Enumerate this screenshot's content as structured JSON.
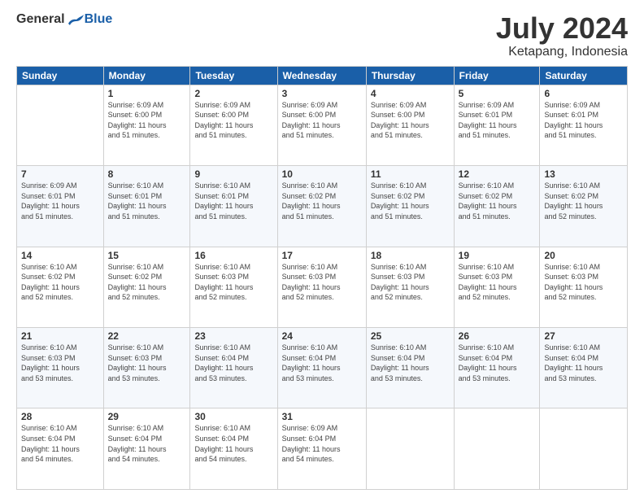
{
  "header": {
    "logo_general": "General",
    "logo_blue": "Blue",
    "month_title": "July 2024",
    "location": "Ketapang, Indonesia"
  },
  "days_header": [
    "Sunday",
    "Monday",
    "Tuesday",
    "Wednesday",
    "Thursday",
    "Friday",
    "Saturday"
  ],
  "weeks": [
    [
      {
        "num": "",
        "info": ""
      },
      {
        "num": "1",
        "info": "Sunrise: 6:09 AM\nSunset: 6:00 PM\nDaylight: 11 hours\nand 51 minutes."
      },
      {
        "num": "2",
        "info": "Sunrise: 6:09 AM\nSunset: 6:00 PM\nDaylight: 11 hours\nand 51 minutes."
      },
      {
        "num": "3",
        "info": "Sunrise: 6:09 AM\nSunset: 6:00 PM\nDaylight: 11 hours\nand 51 minutes."
      },
      {
        "num": "4",
        "info": "Sunrise: 6:09 AM\nSunset: 6:00 PM\nDaylight: 11 hours\nand 51 minutes."
      },
      {
        "num": "5",
        "info": "Sunrise: 6:09 AM\nSunset: 6:01 PM\nDaylight: 11 hours\nand 51 minutes."
      },
      {
        "num": "6",
        "info": "Sunrise: 6:09 AM\nSunset: 6:01 PM\nDaylight: 11 hours\nand 51 minutes."
      }
    ],
    [
      {
        "num": "7",
        "info": "Sunrise: 6:09 AM\nSunset: 6:01 PM\nDaylight: 11 hours\nand 51 minutes."
      },
      {
        "num": "8",
        "info": "Sunrise: 6:10 AM\nSunset: 6:01 PM\nDaylight: 11 hours\nand 51 minutes."
      },
      {
        "num": "9",
        "info": "Sunrise: 6:10 AM\nSunset: 6:01 PM\nDaylight: 11 hours\nand 51 minutes."
      },
      {
        "num": "10",
        "info": "Sunrise: 6:10 AM\nSunset: 6:02 PM\nDaylight: 11 hours\nand 51 minutes."
      },
      {
        "num": "11",
        "info": "Sunrise: 6:10 AM\nSunset: 6:02 PM\nDaylight: 11 hours\nand 51 minutes."
      },
      {
        "num": "12",
        "info": "Sunrise: 6:10 AM\nSunset: 6:02 PM\nDaylight: 11 hours\nand 51 minutes."
      },
      {
        "num": "13",
        "info": "Sunrise: 6:10 AM\nSunset: 6:02 PM\nDaylight: 11 hours\nand 52 minutes."
      }
    ],
    [
      {
        "num": "14",
        "info": "Sunrise: 6:10 AM\nSunset: 6:02 PM\nDaylight: 11 hours\nand 52 minutes."
      },
      {
        "num": "15",
        "info": "Sunrise: 6:10 AM\nSunset: 6:02 PM\nDaylight: 11 hours\nand 52 minutes."
      },
      {
        "num": "16",
        "info": "Sunrise: 6:10 AM\nSunset: 6:03 PM\nDaylight: 11 hours\nand 52 minutes."
      },
      {
        "num": "17",
        "info": "Sunrise: 6:10 AM\nSunset: 6:03 PM\nDaylight: 11 hours\nand 52 minutes."
      },
      {
        "num": "18",
        "info": "Sunrise: 6:10 AM\nSunset: 6:03 PM\nDaylight: 11 hours\nand 52 minutes."
      },
      {
        "num": "19",
        "info": "Sunrise: 6:10 AM\nSunset: 6:03 PM\nDaylight: 11 hours\nand 52 minutes."
      },
      {
        "num": "20",
        "info": "Sunrise: 6:10 AM\nSunset: 6:03 PM\nDaylight: 11 hours\nand 52 minutes."
      }
    ],
    [
      {
        "num": "21",
        "info": "Sunrise: 6:10 AM\nSunset: 6:03 PM\nDaylight: 11 hours\nand 53 minutes."
      },
      {
        "num": "22",
        "info": "Sunrise: 6:10 AM\nSunset: 6:03 PM\nDaylight: 11 hours\nand 53 minutes."
      },
      {
        "num": "23",
        "info": "Sunrise: 6:10 AM\nSunset: 6:04 PM\nDaylight: 11 hours\nand 53 minutes."
      },
      {
        "num": "24",
        "info": "Sunrise: 6:10 AM\nSunset: 6:04 PM\nDaylight: 11 hours\nand 53 minutes."
      },
      {
        "num": "25",
        "info": "Sunrise: 6:10 AM\nSunset: 6:04 PM\nDaylight: 11 hours\nand 53 minutes."
      },
      {
        "num": "26",
        "info": "Sunrise: 6:10 AM\nSunset: 6:04 PM\nDaylight: 11 hours\nand 53 minutes."
      },
      {
        "num": "27",
        "info": "Sunrise: 6:10 AM\nSunset: 6:04 PM\nDaylight: 11 hours\nand 53 minutes."
      }
    ],
    [
      {
        "num": "28",
        "info": "Sunrise: 6:10 AM\nSunset: 6:04 PM\nDaylight: 11 hours\nand 54 minutes."
      },
      {
        "num": "29",
        "info": "Sunrise: 6:10 AM\nSunset: 6:04 PM\nDaylight: 11 hours\nand 54 minutes."
      },
      {
        "num": "30",
        "info": "Sunrise: 6:10 AM\nSunset: 6:04 PM\nDaylight: 11 hours\nand 54 minutes."
      },
      {
        "num": "31",
        "info": "Sunrise: 6:09 AM\nSunset: 6:04 PM\nDaylight: 11 hours\nand 54 minutes."
      },
      {
        "num": "",
        "info": ""
      },
      {
        "num": "",
        "info": ""
      },
      {
        "num": "",
        "info": ""
      }
    ]
  ]
}
